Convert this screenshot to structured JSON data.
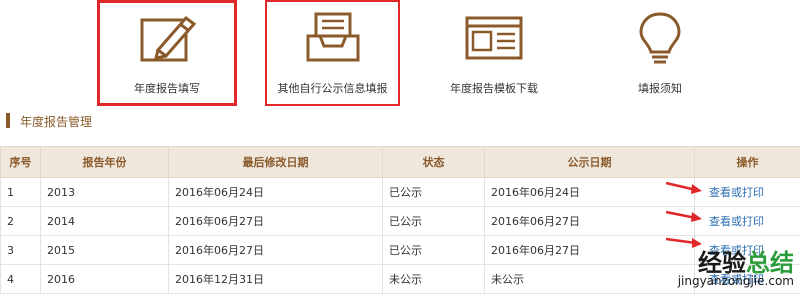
{
  "tiles": [
    {
      "label": "年度报告填写"
    },
    {
      "label": "其他自行公示信息填报"
    },
    {
      "label": "年度报告模板下载"
    },
    {
      "label": "填报须知"
    }
  ],
  "section": {
    "title": "年度报告管理"
  },
  "table": {
    "headers": [
      "序号",
      "报告年份",
      "最后修改日期",
      "状态",
      "公示日期",
      "操作"
    ],
    "rows": [
      {
        "no": "1",
        "year": "2013",
        "modified": "2016年06月24日",
        "status": "已公示",
        "published": "2016年06月24日",
        "action": "查看或打印"
      },
      {
        "no": "2",
        "year": "2014",
        "modified": "2016年06月27日",
        "status": "已公示",
        "published": "2016年06月27日",
        "action": "查看或打印"
      },
      {
        "no": "3",
        "year": "2015",
        "modified": "2016年06月27日",
        "status": "已公示",
        "published": "2016年06月27日",
        "action": "查看或打印"
      },
      {
        "no": "4",
        "year": "2016",
        "modified": "2016年12月31日",
        "status": "未公示",
        "published": "未公示",
        "action": "查看或打印"
      }
    ]
  },
  "watermark": {
    "main_a": "经验",
    "main_b": "总结",
    "url": "jingyanzongjie.com"
  },
  "colors": {
    "accent": "#8a5a2b",
    "header_bg": "#efe7dc",
    "link": "#2d6fb4",
    "highlight": "#e0282a"
  },
  "icons": [
    "pencil-edit-icon",
    "inbox-tray-icon",
    "template-layout-icon",
    "lightbulb-icon",
    "red-arrow-icon"
  ]
}
